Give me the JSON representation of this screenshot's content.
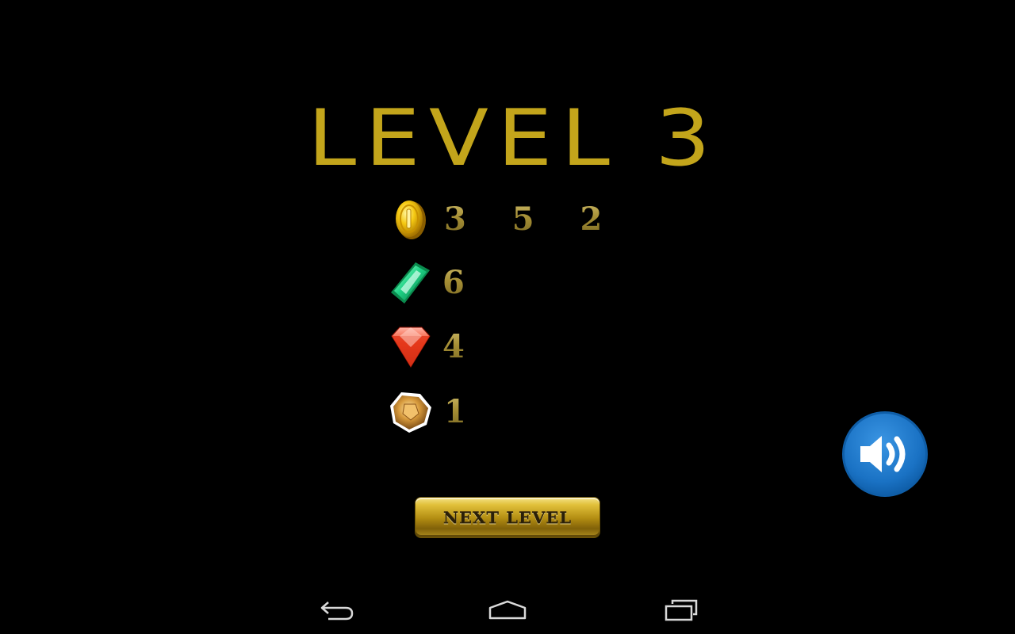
{
  "level": {
    "title": "LEVEL 3",
    "color": "#c3a51b"
  },
  "stats": [
    {
      "icon": "gold-coin-icon",
      "value": "3 5 2"
    },
    {
      "icon": "green-emerald-icon",
      "value": "6"
    },
    {
      "icon": "red-ruby-icon",
      "value": "4"
    },
    {
      "icon": "amber-gem-icon",
      "value": "1"
    }
  ],
  "next_button": {
    "label": "NEXT LEVEL",
    "color": "#b38d12"
  },
  "sound_button": {
    "icon": "speaker-volume-icon",
    "color": "#1a72c4"
  },
  "navigation": {
    "back_icon": "back-arrow-icon",
    "home_icon": "home-icon",
    "recents_icon": "recent-apps-icon"
  }
}
